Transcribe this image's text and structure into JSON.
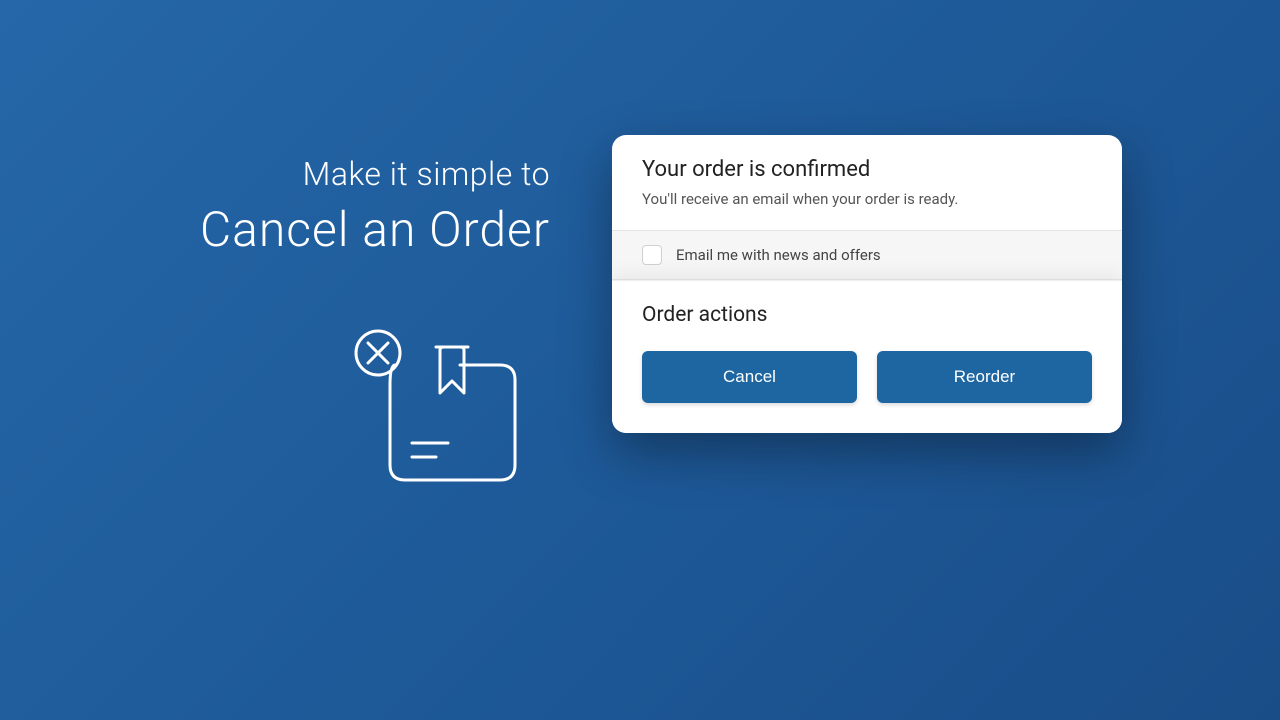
{
  "promo": {
    "line1": "Make it simple to",
    "line2": "Cancel an Order"
  },
  "card": {
    "title": "Your order is confirmed",
    "subtitle": "You'll receive an email when your order is ready.",
    "checkbox_label": "Email me with news and offers",
    "actions_title": "Order actions",
    "cancel_label": "Cancel",
    "reorder_label": "Reorder"
  },
  "colors": {
    "accent": "#1d66a2",
    "background_start": "#2567a8",
    "background_end": "#194d88"
  }
}
